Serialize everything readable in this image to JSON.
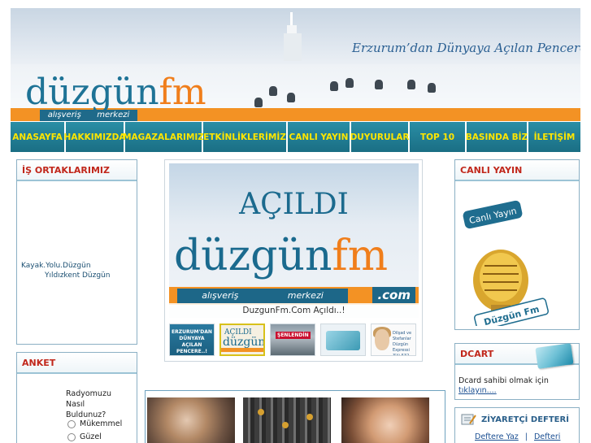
{
  "header": {
    "slogan": "Erzurum’dan Dünyaya Açılan Pencere",
    "brand_left": "düzgün",
    "brand_right": "fm",
    "brand_sub_1": "alışveriş",
    "brand_sub_2": "merkezi"
  },
  "nav": {
    "items": [
      {
        "label": "ANASAYFA"
      },
      {
        "label": "HAKKIMIZDA"
      },
      {
        "label": "MAGAZALARIMIZ"
      },
      {
        "label": "ETKİNLİKLERİMİZ"
      },
      {
        "label": "CANLI YAYIN"
      },
      {
        "label": "DUYURULAR"
      },
      {
        "label": "TOP 10"
      },
      {
        "label": "BASINDA BİZ"
      },
      {
        "label": "İLETİŞİM"
      }
    ]
  },
  "partners": {
    "title": "İŞ ORTAKLARIMIZ",
    "links": [
      "Kayak.Yolu.Düzgün",
      "Yıldızkent Düzgün"
    ]
  },
  "poll": {
    "title": "ANKET",
    "question": "Radyomuzu Nasıl Buldunuz?",
    "options": [
      "Mükemmel",
      "Güzel"
    ]
  },
  "slideshow": {
    "headline": "AÇILDI",
    "brand_left": "düzgün",
    "brand_right": "fm",
    "sub_1": "alışveriş",
    "sub_2": "merkezi",
    "domain": ".com",
    "caption": "DuzgunFm.Com Açıldı..!",
    "thumb1_text": "ERZURUM'DAN DÜNYAYA AÇILAN PENCERE..!",
    "thumb2_top": "AÇILDI",
    "thumb2_left": "düzgün",
    "thumb2_right": "fm",
    "thumb3_label": "ŞENLENDİN",
    "thumb5_text": "Dilşad ve Stefanlar Düzgün Expressi 3'lü 532"
  },
  "live": {
    "title": "CANLI YAYIN",
    "badge": "Canlı Yayın",
    "logo": "Düzgün Fm"
  },
  "dcart": {
    "title": "DCART",
    "text": "Dcard sahibi olmak için",
    "link": "tıklayın...."
  },
  "guestbook": {
    "title": "ZİYARETÇİ DEFTERİ",
    "write": "Deftere Yaz",
    "separator": "|",
    "read": "Defteri"
  },
  "colors": {
    "nav_bg": "#1f7e95",
    "nav_text": "#ffe600",
    "brand_blue": "#1e7396",
    "brand_orange": "#f07e1b",
    "panel_title": "#c1271b"
  }
}
